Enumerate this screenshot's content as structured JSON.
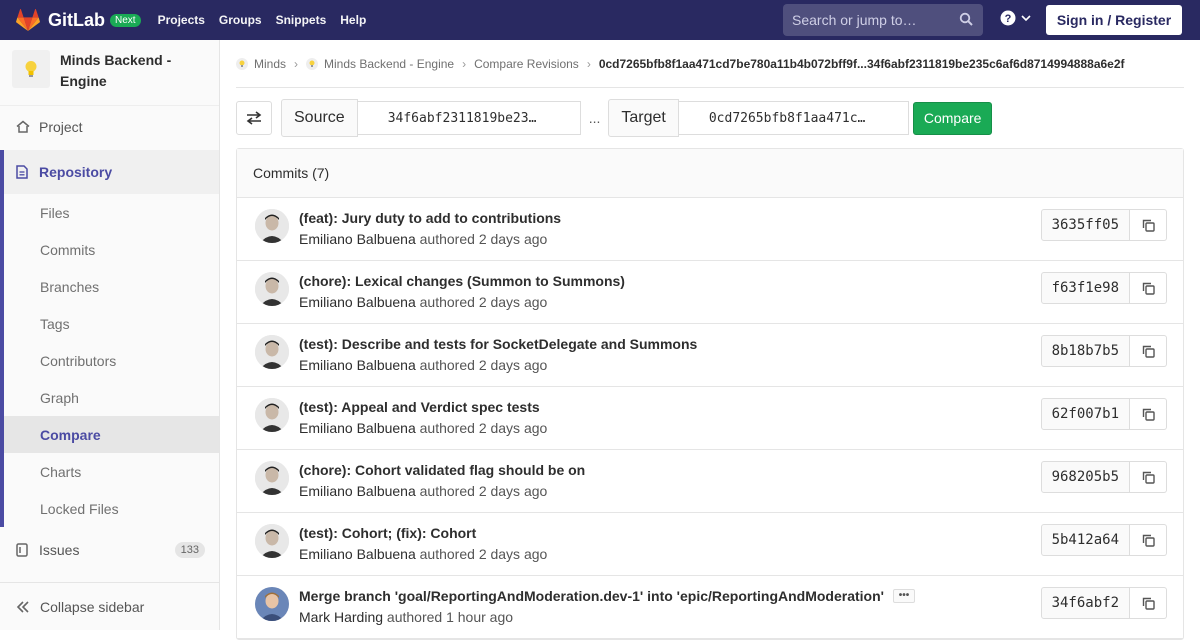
{
  "header": {
    "brand": "GitLab",
    "badge": "Next",
    "nav": [
      "Projects",
      "Groups",
      "Snippets",
      "Help"
    ],
    "search_placeholder": "Search or jump to…",
    "signin_label": "Sign in / Register"
  },
  "sidebar": {
    "project_name": "Minds Backend - Engine",
    "project_item": "Project",
    "repository": "Repository",
    "repo_items": [
      "Files",
      "Commits",
      "Branches",
      "Tags",
      "Contributors",
      "Graph",
      "Compare",
      "Charts",
      "Locked Files"
    ],
    "active_item": "Compare",
    "issues_label": "Issues",
    "issues_count": "133",
    "collapse_label": "Collapse sidebar"
  },
  "breadcrumb": [
    "Minds",
    "Minds Backend - Engine",
    "Compare Revisions",
    "0cd7265bfb8f1aa471cd7be780a11b4b072bff9f...34f6abf2311819be235c6af6d8714994888a6e2f"
  ],
  "compare": {
    "source_label": "Source",
    "source_value": "34f6abf2311819be23…",
    "separator": "...",
    "target_label": "Target",
    "target_value": "0cd7265bfb8f1aa471c…",
    "compare_label": "Compare"
  },
  "commits": {
    "header": "Commits (7)",
    "list": [
      {
        "title": "(feat): Jury duty to add to contributions",
        "author": "Emiliano Balbuena",
        "action": "authored",
        "time": "2 days ago",
        "sha": "3635ff05"
      },
      {
        "title": "(chore): Lexical changes (Summon to Summons)",
        "author": "Emiliano Balbuena",
        "action": "authored",
        "time": "2 days ago",
        "sha": "f63f1e98"
      },
      {
        "title": "(test): Describe and tests for SocketDelegate and Summons",
        "author": "Emiliano Balbuena",
        "action": "authored",
        "time": "2 days ago",
        "sha": "8b18b7b5"
      },
      {
        "title": "(test): Appeal and Verdict spec tests",
        "author": "Emiliano Balbuena",
        "action": "authored",
        "time": "2 days ago",
        "sha": "62f007b1"
      },
      {
        "title": "(chore): Cohort validated flag should be on",
        "author": "Emiliano Balbuena",
        "action": "authored",
        "time": "2 days ago",
        "sha": "968205b5"
      },
      {
        "title": "(test): Cohort; (fix): Cohort",
        "author": "Emiliano Balbuena",
        "action": "authored",
        "time": "2 days ago",
        "sha": "5b412a64"
      },
      {
        "title": "Merge branch 'goal/ReportingAndModeration.dev-1' into 'epic/ReportingAndModeration'",
        "author": "Mark Harding",
        "action": "authored",
        "time": "1 hour ago",
        "sha": "34f6abf2"
      }
    ]
  },
  "colors": {
    "topbar": "#292961",
    "accent": "#4b4ba3",
    "success": "#1aaa55"
  }
}
